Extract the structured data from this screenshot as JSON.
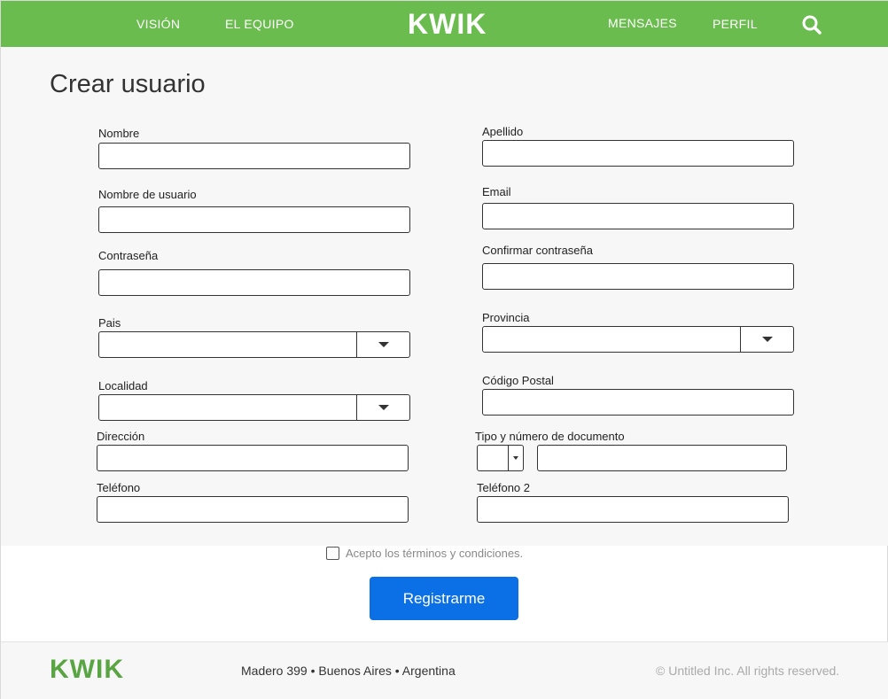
{
  "nav": {
    "left_links": [
      "VISIÓN",
      "EL EQUIPO"
    ],
    "brand": "KWIK",
    "right_links": [
      "MENSAJES",
      "PERFIL"
    ],
    "search_icon": "search-icon"
  },
  "form": {
    "title": "Crear usuario",
    "labels": {
      "nombre": "Nombre",
      "apellido": "Apellido",
      "usuario": "Nombre de usuario",
      "email": "Email",
      "contrasena": "Contraseña",
      "confirmar": "Confirmar contraseña",
      "pais": "Pais",
      "provincia": "Provincia",
      "localidad": "Localidad",
      "codigo_postal": "Código Postal",
      "direccion": "Dirección",
      "documento": "Tipo y número de documento",
      "telefono": "Teléfono",
      "telefono2": "Teléfono 2"
    },
    "terms": "Acepto los términos y condiciones.",
    "submit": "Registrarme"
  },
  "footer": {
    "brand": "KWIK",
    "address": "Madero 399 • Buenos Aires • Argentina",
    "copyright": "© Untitled Inc. All rights reserved."
  },
  "colors": {
    "header_green": "#6bbc4f",
    "footer_brand_green": "#5aa543",
    "button_blue": "#0b6fe6"
  }
}
